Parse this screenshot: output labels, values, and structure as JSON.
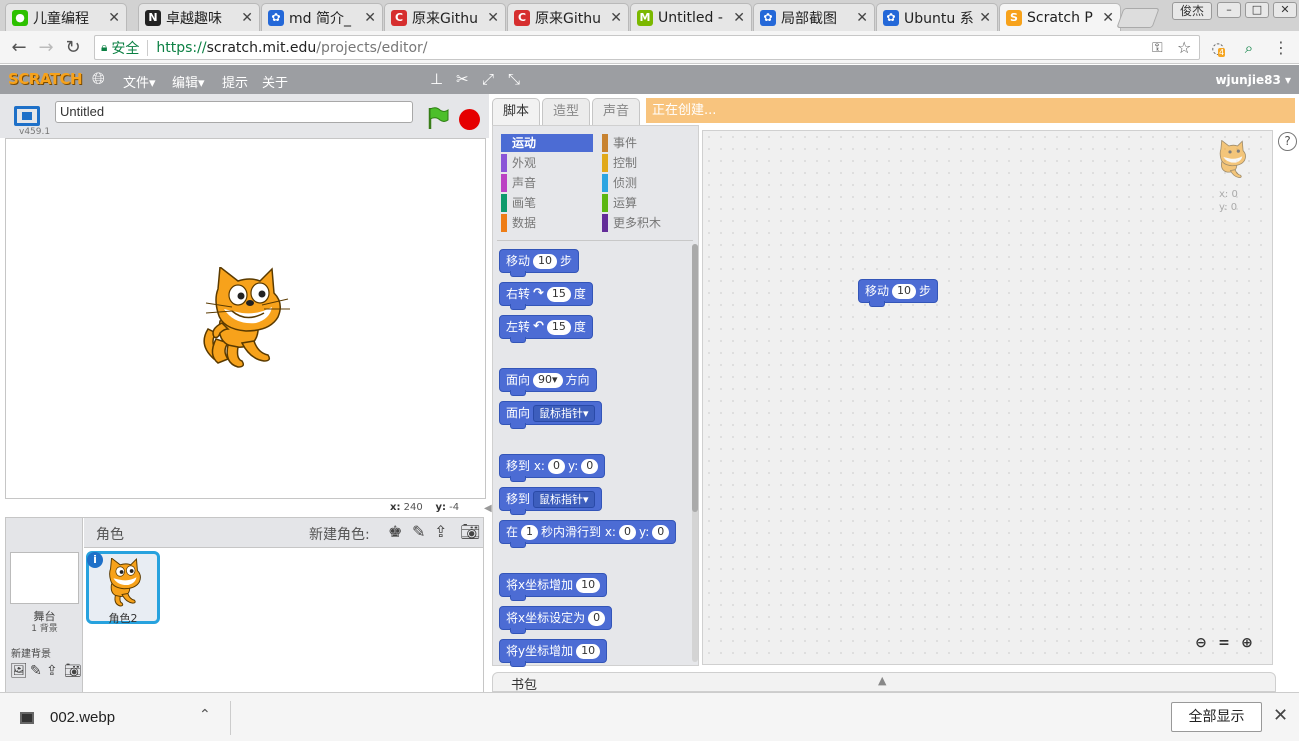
{
  "browser": {
    "tabs": [
      {
        "title": "儿童编程",
        "color": "#2dc100",
        "glyph": "●"
      },
      {
        "title": "卓越趣味",
        "color": "#222222",
        "glyph": "N"
      },
      {
        "title": "md 简介_",
        "color": "#2468d8",
        "glyph": "✿"
      },
      {
        "title": "原来Githu",
        "color": "#d62e2e",
        "glyph": "C"
      },
      {
        "title": "原来Githu",
        "color": "#d62e2e",
        "glyph": "C"
      },
      {
        "title": "Untitled -",
        "color": "#7bb800",
        "glyph": "M"
      },
      {
        "title": "局部截图",
        "color": "#2468d8",
        "glyph": "✿"
      },
      {
        "title": "Ubuntu 系",
        "color": "#2468d8",
        "glyph": "✿"
      },
      {
        "title": "Scratch P",
        "color": "#f7a21b",
        "glyph": "S"
      }
    ],
    "window_user": "俊杰",
    "secure_label": "安全",
    "url_scheme": "https://",
    "url_host": "scratch.mit.edu",
    "url_path": "/projects/editor/",
    "extension_badge": "4"
  },
  "menubar": {
    "logo": "SCRATCH",
    "file": "文件▾",
    "edit": "编辑▾",
    "tips": "提示",
    "about": "关于",
    "username": "wjunjie83 ▾"
  },
  "stage": {
    "version": "v459.1",
    "project_title": "Untitled",
    "coords_x_label": "x:",
    "coords_x": "240",
    "coords_y_label": "y:",
    "coords_y": "-4"
  },
  "sprites": {
    "header": "角色",
    "new_sprite": "新建角色:",
    "stage_label": "舞台",
    "bg_count": "1 背景",
    "new_bg": "新建背景",
    "sprite_name": "角色2",
    "info": "i"
  },
  "editor_tabs": [
    "脚本",
    "造型",
    "声音"
  ],
  "status_banner": "正在创建...",
  "categories": [
    {
      "label": "运动",
      "color": "#4a6cd4",
      "selected": true
    },
    {
      "label": "事件",
      "color": "#c88330"
    },
    {
      "label": "外观",
      "color": "#8a55d7"
    },
    {
      "label": "控制",
      "color": "#e1a91a"
    },
    {
      "label": "声音",
      "color": "#bb42c3"
    },
    {
      "label": "侦测",
      "color": "#2ca5e2"
    },
    {
      "label": "画笔",
      "color": "#0e9a6c"
    },
    {
      "label": "运算",
      "color": "#5cb712"
    },
    {
      "label": "数据",
      "color": "#ee7d16"
    },
    {
      "label": "更多积木",
      "color": "#632d99"
    }
  ],
  "blocks": {
    "move": {
      "pre": "移动",
      "val": "10",
      "post": "步"
    },
    "turn_right": {
      "pre": "右转",
      "val": "15",
      "post": "度"
    },
    "turn_left": {
      "pre": "左转",
      "val": "15",
      "post": "度"
    },
    "point_dir": {
      "pre": "面向",
      "val": "90▾",
      "post": "方向"
    },
    "point_towards": {
      "pre": "面向",
      "dd": "鼠标指针▾"
    },
    "goto_xy": {
      "pre": "移到 x:",
      "x": "0",
      "mid": "y:",
      "y": "0"
    },
    "goto": {
      "pre": "移到",
      "dd": "鼠标指针▾"
    },
    "glide": {
      "pre": "在",
      "secs": "1",
      "mid": "秒内滑行到 x:",
      "x": "0",
      "ylab": "y:",
      "y": "0"
    },
    "change_x": {
      "pre": "将x坐标增加",
      "val": "10"
    },
    "set_x": {
      "pre": "将x坐标设定为",
      "val": "0"
    },
    "change_y": {
      "pre": "将y坐标增加",
      "val": "10"
    }
  },
  "script_block": {
    "pre": "移动",
    "val": "10",
    "post": "步"
  },
  "corner": {
    "x": "x: 0",
    "y": "y: 0"
  },
  "backpack": "书包",
  "download": {
    "filename": "002.webp",
    "show_all": "全部显示"
  }
}
